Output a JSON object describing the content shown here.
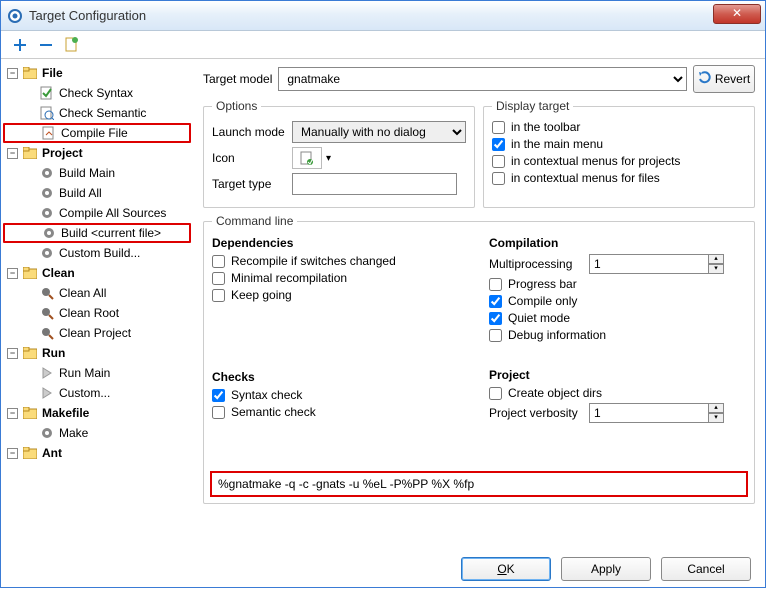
{
  "window": {
    "title": "Target Configuration",
    "close": "✕"
  },
  "tree": {
    "file": {
      "label": "File",
      "children": [
        {
          "label": "Check Syntax"
        },
        {
          "label": "Check Semantic"
        },
        {
          "label": "Compile File",
          "hl": true
        }
      ]
    },
    "project": {
      "label": "Project",
      "children": [
        {
          "label": "Build Main"
        },
        {
          "label": "Build All"
        },
        {
          "label": "Compile All Sources"
        },
        {
          "label": "Build <current file>",
          "hl": true
        },
        {
          "label": "Custom Build..."
        }
      ]
    },
    "clean": {
      "label": "Clean",
      "children": [
        {
          "label": "Clean All"
        },
        {
          "label": "Clean Root"
        },
        {
          "label": "Clean Project"
        }
      ]
    },
    "run": {
      "label": "Run",
      "children": [
        {
          "label": "Run Main"
        },
        {
          "label": "Custom..."
        }
      ]
    },
    "makefile": {
      "label": "Makefile",
      "children": [
        {
          "label": "Make"
        }
      ]
    },
    "ant": {
      "label": "Ant",
      "children": []
    }
  },
  "model": {
    "label": "Target model",
    "value": "gnatmake",
    "revert": "Revert"
  },
  "options": {
    "legend": "Options",
    "launch_label": "Launch mode",
    "launch_value": "Manually with no dialog",
    "icon_label": "Icon",
    "target_type_label": "Target type",
    "target_type_value": ""
  },
  "display": {
    "legend": "Display target",
    "toolbar": "in the toolbar",
    "mainmenu": "in the main menu",
    "ctx_proj": "in contextual menus for projects",
    "ctx_file": "in contextual menus for files"
  },
  "cmd": {
    "legend": "Command line",
    "deps": {
      "h": "Dependencies",
      "recompile": "Recompile if switches changed",
      "minimal": "Minimal recompilation",
      "keep": "Keep going"
    },
    "checks": {
      "h": "Checks",
      "syntax": "Syntax check",
      "semantic": "Semantic check"
    },
    "comp": {
      "h": "Compilation",
      "multi_label": "Multiprocessing",
      "multi_value": "1",
      "progress": "Progress bar",
      "compile_only": "Compile only",
      "quiet": "Quiet mode",
      "debug": "Debug information"
    },
    "proj": {
      "h": "Project",
      "create_obj": "Create object dirs",
      "verbosity_label": "Project verbosity",
      "verbosity_value": "1"
    },
    "line": "%gnatmake -q -c -gnats -u %eL -P%PP %X %fp"
  },
  "buttons": {
    "ok": "OK",
    "apply": "Apply",
    "cancel": "Cancel"
  }
}
